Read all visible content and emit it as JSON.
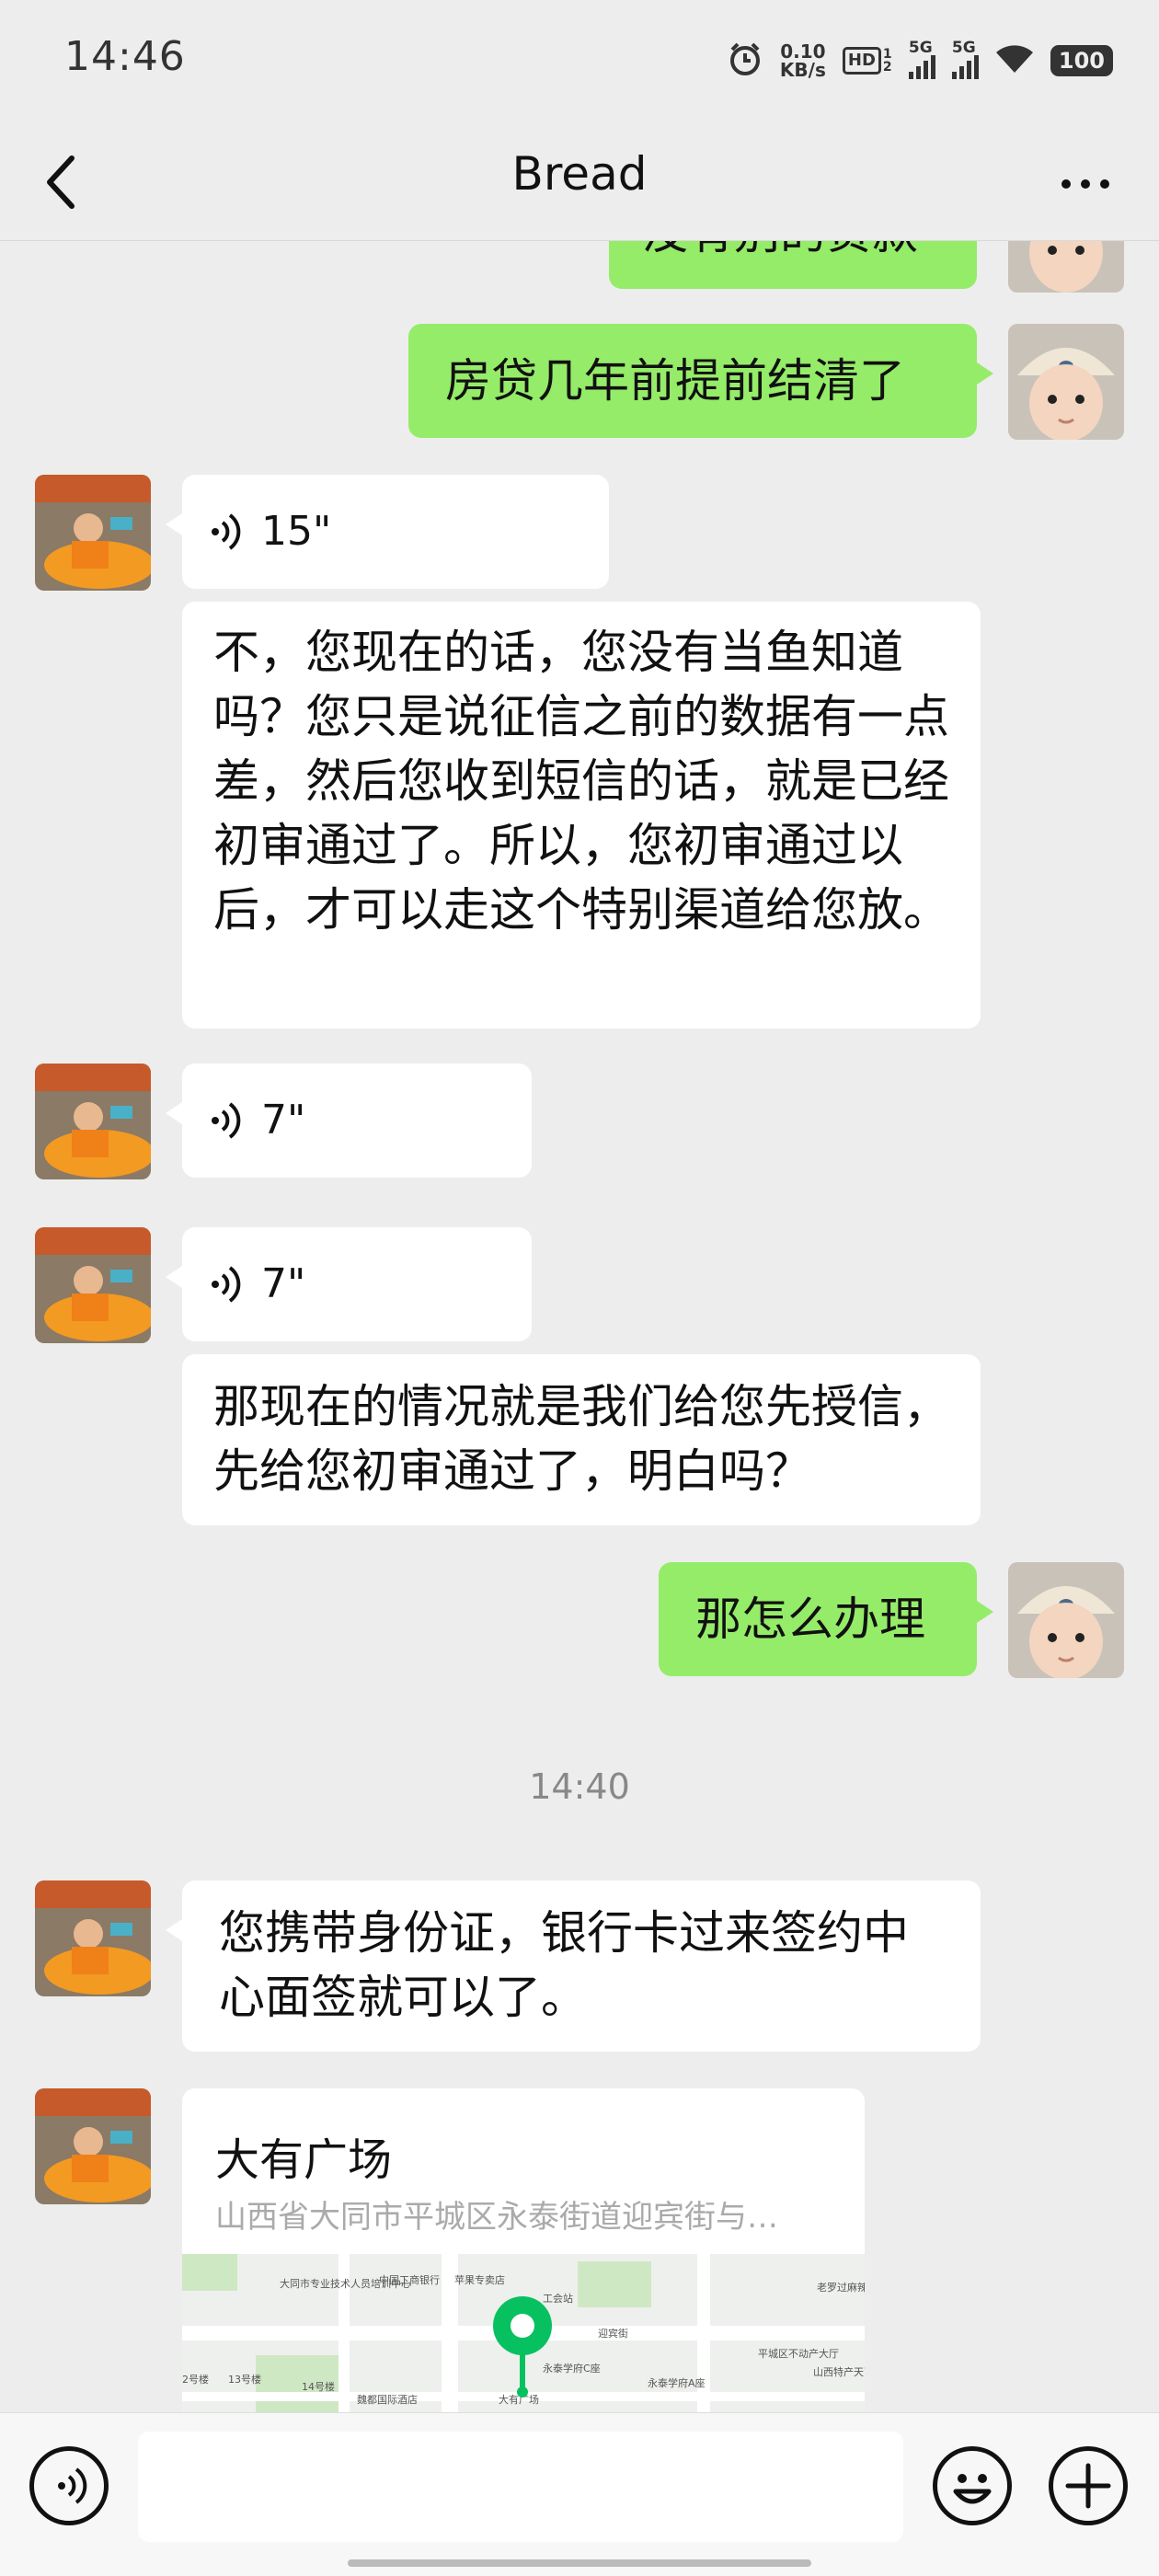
{
  "status_bar": {
    "time": "14:46",
    "net_speed_value": "0.10",
    "net_speed_unit": "KB/s",
    "hd_label": "HD",
    "hd_sub": "1 2",
    "signal1_label": "5G",
    "signal2_label": "5G",
    "battery": "100",
    "icons": [
      "alarm-icon",
      "hd-icon",
      "signal-icon",
      "signal-icon",
      "wifi-icon",
      "battery-icon"
    ]
  },
  "header": {
    "title": "Bread",
    "back_icon": "chevron-left-icon",
    "more_icon": "more-dots-icon"
  },
  "messages": [
    {
      "from": "me",
      "type": "text",
      "text": "没有别的贷款"
    },
    {
      "from": "me",
      "type": "text",
      "text": "房贷几年前提前结清了"
    },
    {
      "from": "other",
      "type": "voice",
      "duration": "15\""
    },
    {
      "from": "other",
      "type": "text",
      "text": "不，您现在的话，您没有当鱼知道吗？您只是说征信之前的数据有一点差，然后您收到短信的话，就是已经初审通过了。所以，您初审通过以后，才可以走这个特别渠道给您放。"
    },
    {
      "from": "other",
      "type": "voice",
      "duration": "7\""
    },
    {
      "from": "other",
      "type": "voice",
      "duration": "7\""
    },
    {
      "from": "other",
      "type": "text",
      "text": "那现在的情况就是我们给您先授信，先给您初审通过了，明白吗？"
    },
    {
      "from": "me",
      "type": "text",
      "text": "那怎么办理"
    },
    {
      "type": "timestamp",
      "text": "14:40"
    },
    {
      "from": "other",
      "type": "text",
      "text": "您携带身份证，银行卡过来签约中心面签就可以了。"
    },
    {
      "from": "other",
      "type": "location",
      "name": "大有广场",
      "address": "山西省大同市平城区永泰街道迎宾街与…"
    }
  ],
  "map_labels": {
    "school": "大同市专业技术人员培训中心",
    "bank": "中国工商银行",
    "apple": "苹果专卖店",
    "union_station": "工会站",
    "yingbin": "迎宾街",
    "hotel": "魏都国际酒店",
    "plaza": "大有广场",
    "land_hall": "平城区不动产大厅",
    "shanxi": "山西特产天下酒",
    "school_c": "永泰学府C座",
    "school_a": "永泰学府A座",
    "laoxiang": "老罗过麻辣烫",
    "bldg13": "13号楼",
    "bldg14": "14号楼",
    "bldg2": "2号楼"
  },
  "bottom_bar": {
    "voice_icon": "voice-input-icon",
    "emoji_icon": "emoji-icon",
    "plus_icon": "plus-icon"
  },
  "colors": {
    "background": "#ededed",
    "outgoing_bubble": "#95ec69",
    "incoming_bubble": "#ffffff",
    "map_pin": "#07c160"
  }
}
